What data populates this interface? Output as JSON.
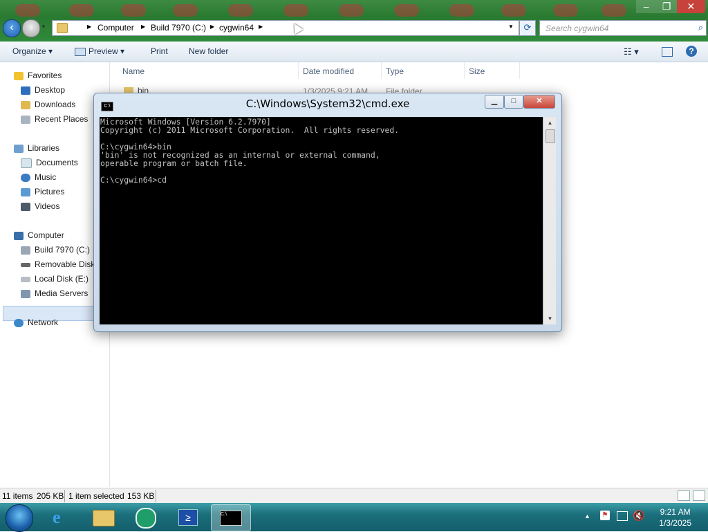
{
  "explorer": {
    "address": {
      "segments": [
        "Computer",
        "Build 7970 (C:)",
        "cygwin64"
      ]
    },
    "search_placeholder": "Search cygwin64",
    "toolbar": {
      "organize": "Organize",
      "preview": "Preview",
      "print": "Print",
      "new_folder": "New folder"
    },
    "nav": {
      "favorites": "Favorites",
      "desktop": "Desktop",
      "downloads": "Downloads",
      "recent_places": "Recent Places",
      "libraries": "Libraries",
      "documents": "Documents",
      "music": "Music",
      "pictures": "Pictures",
      "videos": "Videos",
      "computer": "Computer",
      "build": "Build 7970 (C:)",
      "removable": "Removable Disk (",
      "local_disk": "Local Disk (E:)",
      "media_servers": "Media Servers",
      "network": "Network"
    },
    "columns": {
      "name": "Name",
      "date": "Date modified",
      "type": "Type",
      "size": "Size"
    },
    "rows": [
      {
        "name": "bin",
        "date": "1/3/2025 9:21 AM",
        "type": "File folder"
      }
    ],
    "status": {
      "items": "11 items",
      "items_size": "205 KB",
      "selected": "1 item selected",
      "selected_size": "153 KB"
    }
  },
  "cmd": {
    "title": "C:\\Windows\\System32\\cmd.exe",
    "output": "Microsoft Windows [Version 6.2.7970]\nCopyright (c) 2011 Microsoft Corporation.  All rights reserved.\n\nC:\\cygwin64>bin\n'bin' is not recognized as an internal or external command,\noperable program or batch file.\n\nC:\\cygwin64>cd"
  },
  "taskbar": {
    "time": "9:21 AM",
    "date": "1/3/2025"
  },
  "colors": {
    "title_green": "#2a7a32",
    "taskbar_teal": "#1c6f7c",
    "console_bg": "#000000",
    "console_fg": "#c0c0c0",
    "selection": "#d9e7f7"
  }
}
